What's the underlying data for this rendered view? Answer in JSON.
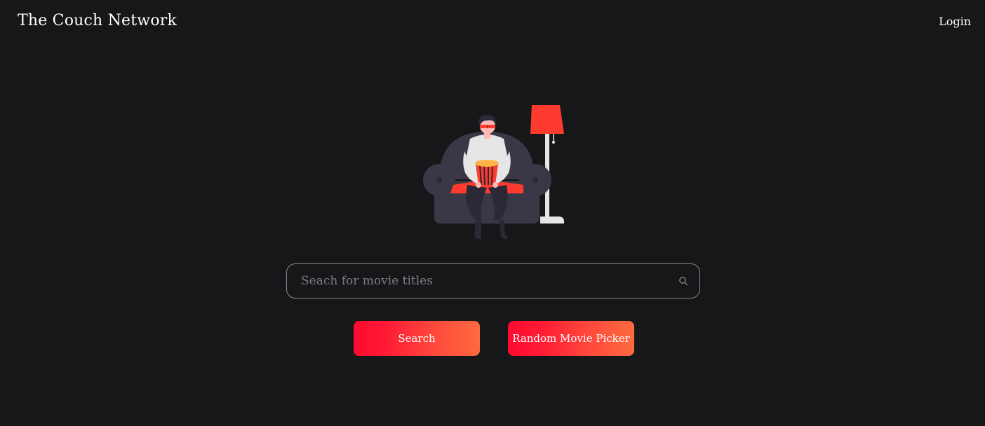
{
  "header": {
    "brand": "The Couch Network",
    "login_label": "Login"
  },
  "hero": {
    "illustration": "person-on-armchair-with-popcorn-and-lamp"
  },
  "search": {
    "placeholder": "Seach for movie titles",
    "value": "",
    "icon": "search-icon"
  },
  "actions": {
    "search_label": "Search",
    "random_label": "Random Movie Picker"
  },
  "colors": {
    "background": "#161719",
    "accent_start": "#ff0a2f",
    "accent_end": "#ff6a3f",
    "lamp": "#ff3b30",
    "couch": "#3a3847"
  }
}
